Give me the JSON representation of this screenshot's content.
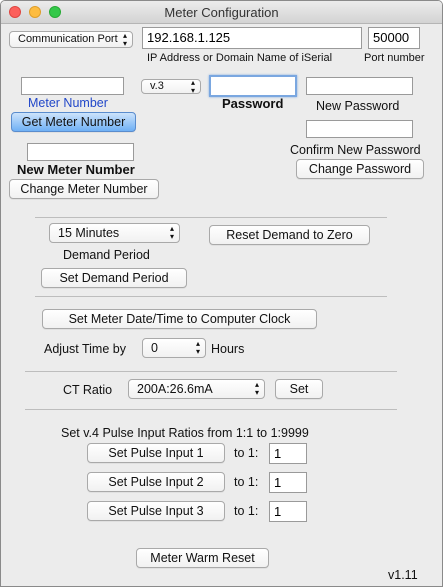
{
  "window": {
    "title": "Meter Configuration"
  },
  "connection": {
    "port_selector": "Communication Port",
    "ip_value": "192.168.1.125",
    "ip_label": "IP Address or Domain Name of iSerial",
    "port_value": "50000",
    "port_label": "Port number"
  },
  "meter": {
    "number_value": "",
    "number_label": "Meter Number",
    "version_selector": "v.3",
    "get_button": "Get Meter Number",
    "new_number_value": "",
    "new_number_label": "New Meter Number",
    "change_button": "Change Meter Number"
  },
  "password": {
    "value": "",
    "label": "Password",
    "new_value": "",
    "new_label": "New Password",
    "confirm_value": "",
    "confirm_label": "Confirm New Password",
    "change_button": "Change Password"
  },
  "demand": {
    "period_selector": "15 Minutes",
    "period_label": "Demand Period",
    "reset_button": "Reset Demand to Zero",
    "set_button": "Set Demand Period"
  },
  "clock": {
    "set_button": "Set Meter Date/Time to Computer Clock",
    "adjust_label": "Adjust Time by",
    "adjust_value": "0",
    "hours_label": "Hours"
  },
  "ct": {
    "label": "CT Ratio",
    "selector": "200A:26.6mA",
    "set_button": "Set"
  },
  "pulse": {
    "heading": "Set v.4 Pulse Input Ratios from 1:1 to 1:9999",
    "inputs": [
      {
        "button": "Set Pulse Input 1",
        "to_label": "to 1:",
        "value": "1"
      },
      {
        "button": "Set Pulse Input 2",
        "to_label": "to 1:",
        "value": "1"
      },
      {
        "button": "Set Pulse Input 3",
        "to_label": "to 1:",
        "value": "1"
      }
    ]
  },
  "footer": {
    "warm_reset_button": "Meter Warm Reset",
    "version": "v1.11"
  },
  "icons": {
    "popup_arrows": "up-down-chevron-icon",
    "close": "close-icon",
    "minimize": "minimize-icon",
    "maximize": "maximize-icon"
  },
  "colors": {
    "accent_blue_label": "#2147c9",
    "default_button": "#6fb0f5",
    "close_dot": "#fc605c",
    "minimize_dot": "#fdbc40",
    "maximize_dot": "#34c84a"
  }
}
